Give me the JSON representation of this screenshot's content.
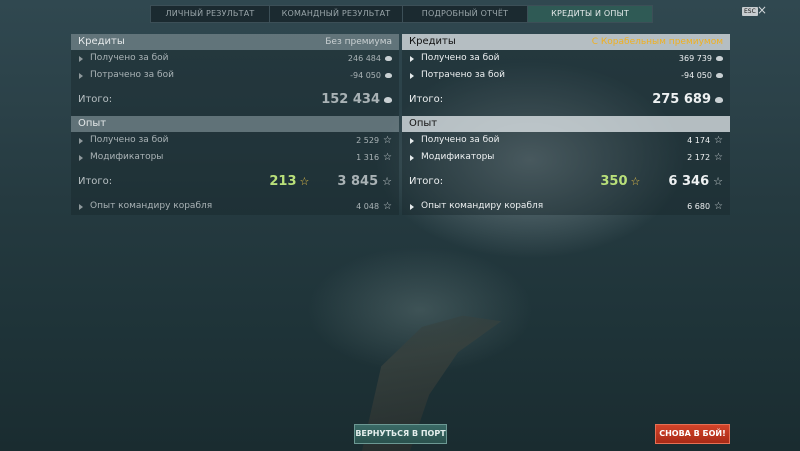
{
  "tabs": [
    {
      "label": "ЛИЧНЫЙ РЕЗУЛЬТАТ",
      "active": false
    },
    {
      "label": "КОМАНДНЫЙ РЕЗУЛЬТАТ",
      "active": false
    },
    {
      "label": "ПОДРОБНЫЙ ОТЧЁТ",
      "active": false
    },
    {
      "label": "КРЕДИТЫ И ОПЫТ",
      "active": true
    }
  ],
  "esc_label": "ESC",
  "close_symbol": "×",
  "left": {
    "credits_header": "Кредиты",
    "credits_sub": "Без премиума",
    "credits_rows": [
      {
        "label": "Получено за бой",
        "value": "246 484"
      },
      {
        "label": "Потрачено за бой",
        "value": "-94 050"
      }
    ],
    "credits_total_label": "Итого:",
    "credits_total": "152 434",
    "xp_header": "Опыт",
    "xp_rows": [
      {
        "label": "Получено за бой",
        "value": "2 529"
      },
      {
        "label": "Модификаторы",
        "value": "1 316"
      }
    ],
    "xp_total_label": "Итого:",
    "xp_elite": "213",
    "xp_total": "3 845",
    "commander_label": "Опыт командиру корабля",
    "commander_value": "4 048"
  },
  "right": {
    "credits_header": "Кредиты",
    "credits_sub": "С Корабельным премиумом",
    "credits_rows": [
      {
        "label": "Получено за бой",
        "value": "369 739"
      },
      {
        "label": "Потрачено за бой",
        "value": "-94 050"
      }
    ],
    "credits_total_label": "Итого:",
    "credits_total": "275 689",
    "xp_header": "Опыт",
    "xp_rows": [
      {
        "label": "Получено за бой",
        "value": "4 174"
      },
      {
        "label": "Модификаторы",
        "value": "2 172"
      }
    ],
    "xp_total_label": "Итого:",
    "xp_elite": "350",
    "xp_total": "6 346",
    "commander_label": "Опыт командиру корабля",
    "commander_value": "6 680"
  },
  "buttons": {
    "port": "ВЕРНУТЬСЯ В ПОРТ",
    "battle": "СНОВА В БОЙ!"
  },
  "icons": {
    "credit": "credit-coin-icon",
    "xp": "star-icon",
    "elite_xp": "elite-star-icon",
    "row_marker": "triangle-right-icon"
  },
  "colors": {
    "premium_accent": "#f0b020",
    "elite_xp": "#b9e07a",
    "battle_button": "#c23a22",
    "port_button": "#2f5a55"
  }
}
